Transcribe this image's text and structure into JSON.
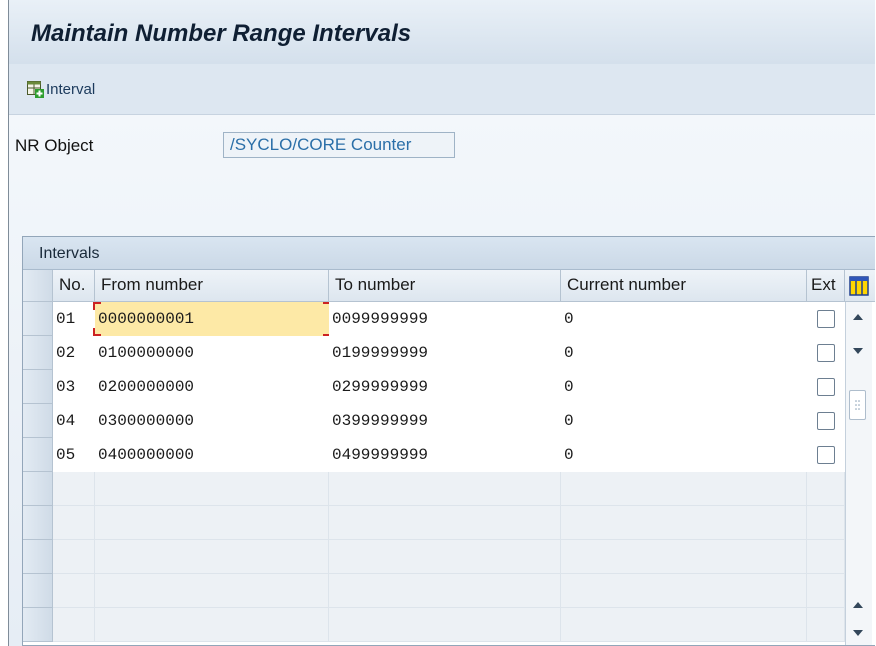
{
  "window": {
    "title": "Maintain Number Range Intervals"
  },
  "toolbar": {
    "interval_button": "Interval",
    "interval_icon": "insert-interval-icon"
  },
  "nr_object": {
    "label": "NR Object",
    "value": "/SYCLO/CORE Counter"
  },
  "intervals": {
    "title": "Intervals",
    "columns": {
      "no": "No.",
      "from": "From number",
      "to": "To number",
      "current": "Current number",
      "ext": "Ext"
    },
    "rows": [
      {
        "no": "01",
        "from": "0000000001",
        "to": "0099999999",
        "current": "0",
        "ext": false
      },
      {
        "no": "02",
        "from": "0100000000",
        "to": "0199999999",
        "current": "0",
        "ext": false
      },
      {
        "no": "03",
        "from": "0200000000",
        "to": "0299999999",
        "current": "0",
        "ext": false
      },
      {
        "no": "04",
        "from": "0300000000",
        "to": "0399999999",
        "current": "0",
        "ext": false
      },
      {
        "no": "05",
        "from": "0400000000",
        "to": "0499999999",
        "current": "0",
        "ext": false
      }
    ],
    "selected_cell": "rows.0.from"
  },
  "colors": {
    "selection": "#fde9a6",
    "focus_bracket": "#cc2222",
    "field_text": "#2b6fa8"
  }
}
